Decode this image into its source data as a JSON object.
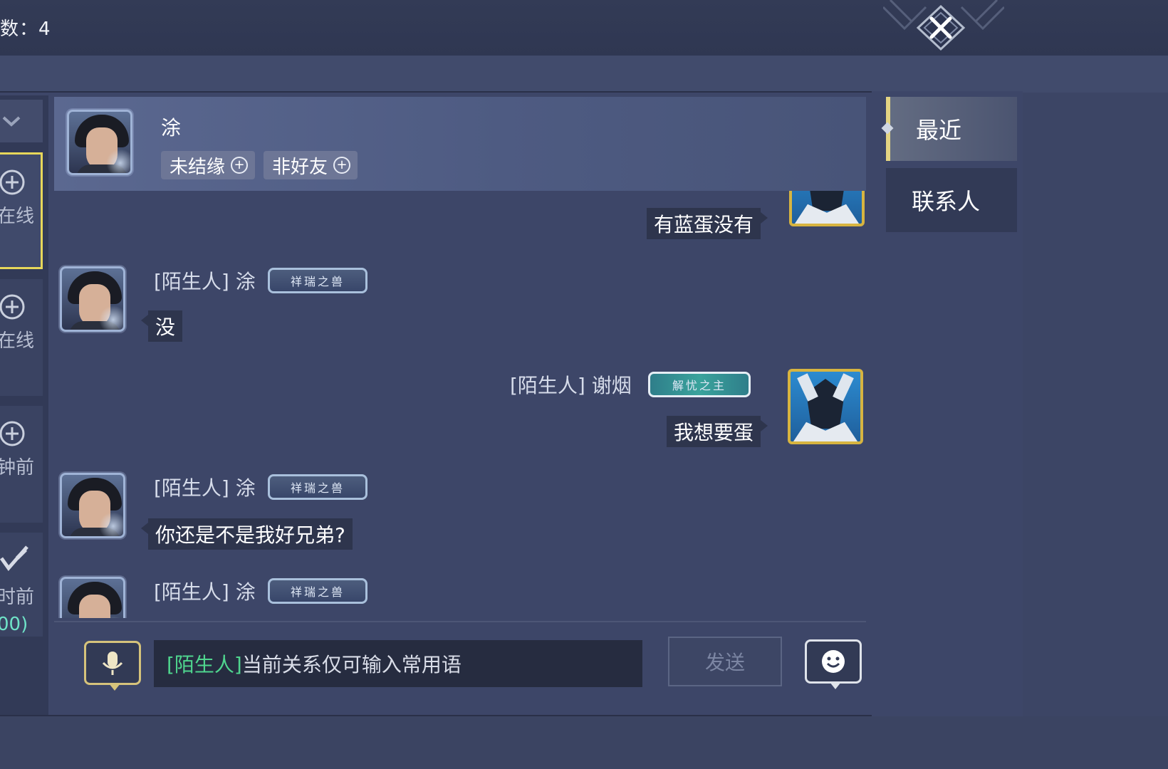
{
  "topbar": {
    "count_label": "数：4"
  },
  "left_list": {
    "items": [
      {
        "label": "在线",
        "extra": ""
      },
      {
        "label": "在线",
        "extra": ""
      },
      {
        "label": "钟前",
        "extra": ""
      },
      {
        "label": "时前",
        "extra": "00)"
      }
    ]
  },
  "chat_header": {
    "name": "涂",
    "tags": [
      {
        "label": "未结缘"
      },
      {
        "label": "非好友"
      }
    ]
  },
  "messages": [
    {
      "side": "right",
      "sender": "",
      "badge": "",
      "text": "有蓝蛋没有"
    },
    {
      "side": "left",
      "sender": "[陌生人] 涂",
      "badge": "祥瑞之兽",
      "text": "没"
    },
    {
      "side": "right",
      "sender": "[陌生人] 谢烟",
      "badge": "解忧之主",
      "text": "我想要蛋"
    },
    {
      "side": "left",
      "sender": "[陌生人] 涂",
      "badge": "祥瑞之兽",
      "text": "你还是不是我好兄弟?"
    },
    {
      "side": "left",
      "sender": "[陌生人] 涂",
      "badge": "祥瑞之兽",
      "text": ""
    }
  ],
  "input_bar": {
    "placeholder_tag": "[陌生人]",
    "placeholder_text": "当前关系仅可输入常用语",
    "send_label": "发送"
  },
  "tabs": [
    {
      "label": "最近",
      "active": true
    },
    {
      "label": "联系人",
      "active": false
    }
  ],
  "colors": {
    "background": "#3c4565",
    "accent_gold": "#e7d75a",
    "stranger_tag": "#4fd58e"
  }
}
